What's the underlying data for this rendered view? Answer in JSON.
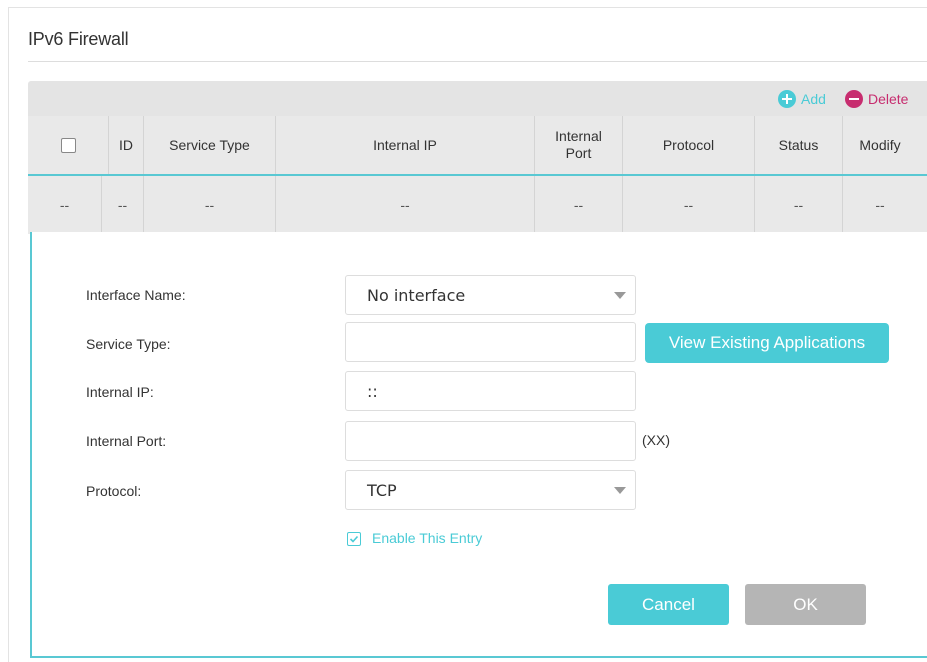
{
  "page": {
    "title": "IPv6 Firewall"
  },
  "toolbar": {
    "add_label": "Add",
    "delete_label": "Delete"
  },
  "table": {
    "headers": [
      "",
      "ID",
      "Service Type",
      "Internal IP",
      "Internal Port",
      "Protocol",
      "Status",
      "Modify"
    ],
    "header_internal_port": [
      "Internal",
      "Port"
    ],
    "row": [
      "--",
      "--",
      "--",
      "--",
      "--",
      "--",
      "--",
      "--"
    ]
  },
  "form": {
    "interface_label": "Interface Name:",
    "interface_value": "No interface",
    "service_label": "Service Type:",
    "service_value": "",
    "view_apps_label": "View Existing Applications",
    "ip_label": "Internal IP:",
    "ip_value": "::",
    "port_label": "Internal Port:",
    "port_value": "",
    "port_hint": "(XX)",
    "protocol_label": "Protocol:",
    "protocol_value": "TCP",
    "enable_label": "Enable This Entry",
    "enable_checked": true,
    "cancel_label": "Cancel",
    "ok_label": "OK"
  },
  "colors": {
    "accent": "#4acbd6",
    "delete": "#c72d6f",
    "disabled": "#b5b5b5"
  },
  "icons": {
    "add": "plus-circle-icon",
    "delete": "minus-circle-icon",
    "select": "chevron-down-icon",
    "check": "checkmark-icon"
  }
}
